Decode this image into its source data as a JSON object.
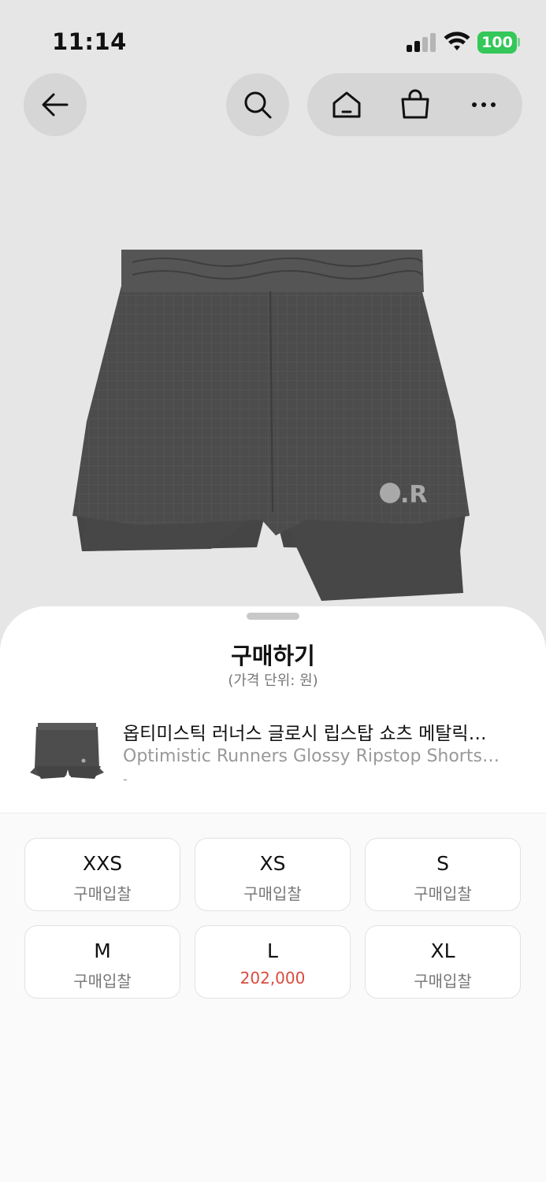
{
  "status_bar": {
    "time": "11:14",
    "battery": "100"
  },
  "sheet": {
    "title": "구매하기",
    "subtitle": "(가격 단위: 원)",
    "product": {
      "name_ko": "옵티미스틱 러너스 글로시 립스탑 쇼츠 메탈릭…",
      "name_en": "Optimistic Runners Glossy Ripstop Shorts…",
      "extra": "-",
      "logo_text": ".R"
    },
    "sizes": [
      {
        "label": "XXS",
        "price": "구매입찰",
        "highlight": false
      },
      {
        "label": "XS",
        "price": "구매입찰",
        "highlight": false
      },
      {
        "label": "S",
        "price": "구매입찰",
        "highlight": false
      },
      {
        "label": "M",
        "price": "구매입찰",
        "highlight": false
      },
      {
        "label": "L",
        "price": "202,000",
        "highlight": true
      },
      {
        "label": "XL",
        "price": "구매입찰",
        "highlight": false
      }
    ]
  },
  "colors": {
    "price_highlight": "#d94b3e",
    "battery": "#34c759",
    "shorts": "#4a4a4a"
  },
  "icons": [
    "back-arrow-icon",
    "search-icon",
    "home-icon",
    "shopping-bag-icon",
    "more-icon"
  ]
}
